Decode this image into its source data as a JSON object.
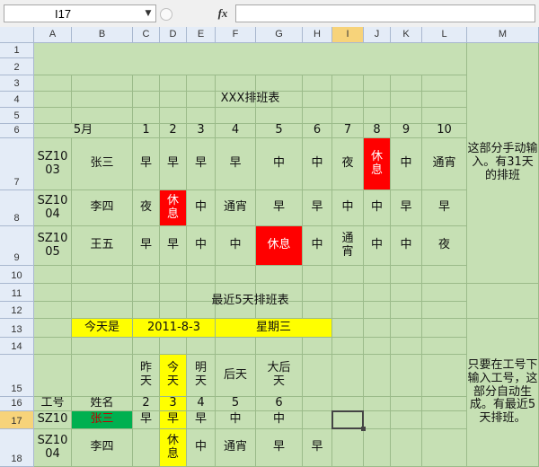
{
  "toolbar": {
    "name_box": "I17",
    "fx_label": "fx",
    "formula": ""
  },
  "columns": [
    "A",
    "B",
    "C",
    "D",
    "E",
    "F",
    "G",
    "H",
    "I",
    "J",
    "K",
    "L",
    "M"
  ],
  "rows": [
    "1",
    "2",
    "3",
    "4",
    "5",
    "6",
    "7",
    "8",
    "9",
    "10",
    "11",
    "12",
    "13",
    "14",
    "15",
    "16",
    "17",
    "18"
  ],
  "selected": {
    "column": "I",
    "row": "17",
    "cell": "I17"
  },
  "section1": {
    "title": "XXX排班表",
    "month": "5月",
    "days": [
      "1",
      "2",
      "3",
      "4",
      "5",
      "6",
      "7",
      "8",
      "9",
      "10"
    ],
    "note": "这部分手动输入。有31天的排班",
    "employees": [
      {
        "id": "SZ10\n03",
        "name": "张三",
        "shifts": [
          "早",
          "早",
          "早",
          "早",
          "中",
          "中",
          "夜",
          "休\n息",
          "中",
          "通宵"
        ]
      },
      {
        "id": "SZ10\n04",
        "name": "李四",
        "shifts": [
          "夜",
          "休\n息",
          "中",
          "通宵",
          "早",
          "早",
          "中",
          "中",
          "早",
          "早"
        ]
      },
      {
        "id": "SZ10\n05",
        "name": "王五",
        "shifts": [
          "早",
          "早",
          "中",
          "中",
          "休息",
          "中",
          "通\n宵",
          "中",
          "中",
          "夜"
        ]
      }
    ]
  },
  "section2": {
    "title": "最近5天排班表",
    "today_label": "今天是",
    "date": "2011-8-3",
    "weekday": "星期三",
    "headers": [
      "昨\n天",
      "今\n天",
      "明\n天",
      "后天",
      "大后\n天"
    ],
    "id_header": "工号",
    "name_header": "姓名",
    "day_numbers": [
      "2",
      "3",
      "4",
      "5",
      "6"
    ],
    "note": "只要在工号下输入工号，这部分自动生成。有最近5天排班。",
    "rows": [
      {
        "id": "SZ10",
        "name": "张三",
        "shifts": [
          "早",
          "早",
          "早",
          "中",
          "中"
        ]
      },
      {
        "id": "SZ10\n04",
        "name": "李四",
        "shifts": [
          "",
          "休\n息",
          "中",
          "通宵",
          "早",
          "早"
        ]
      }
    ]
  },
  "colors": {
    "rest": "#ff0000",
    "highlight": "#ffff00",
    "selected_name": "#00b050",
    "background": "#c6e0b4"
  }
}
